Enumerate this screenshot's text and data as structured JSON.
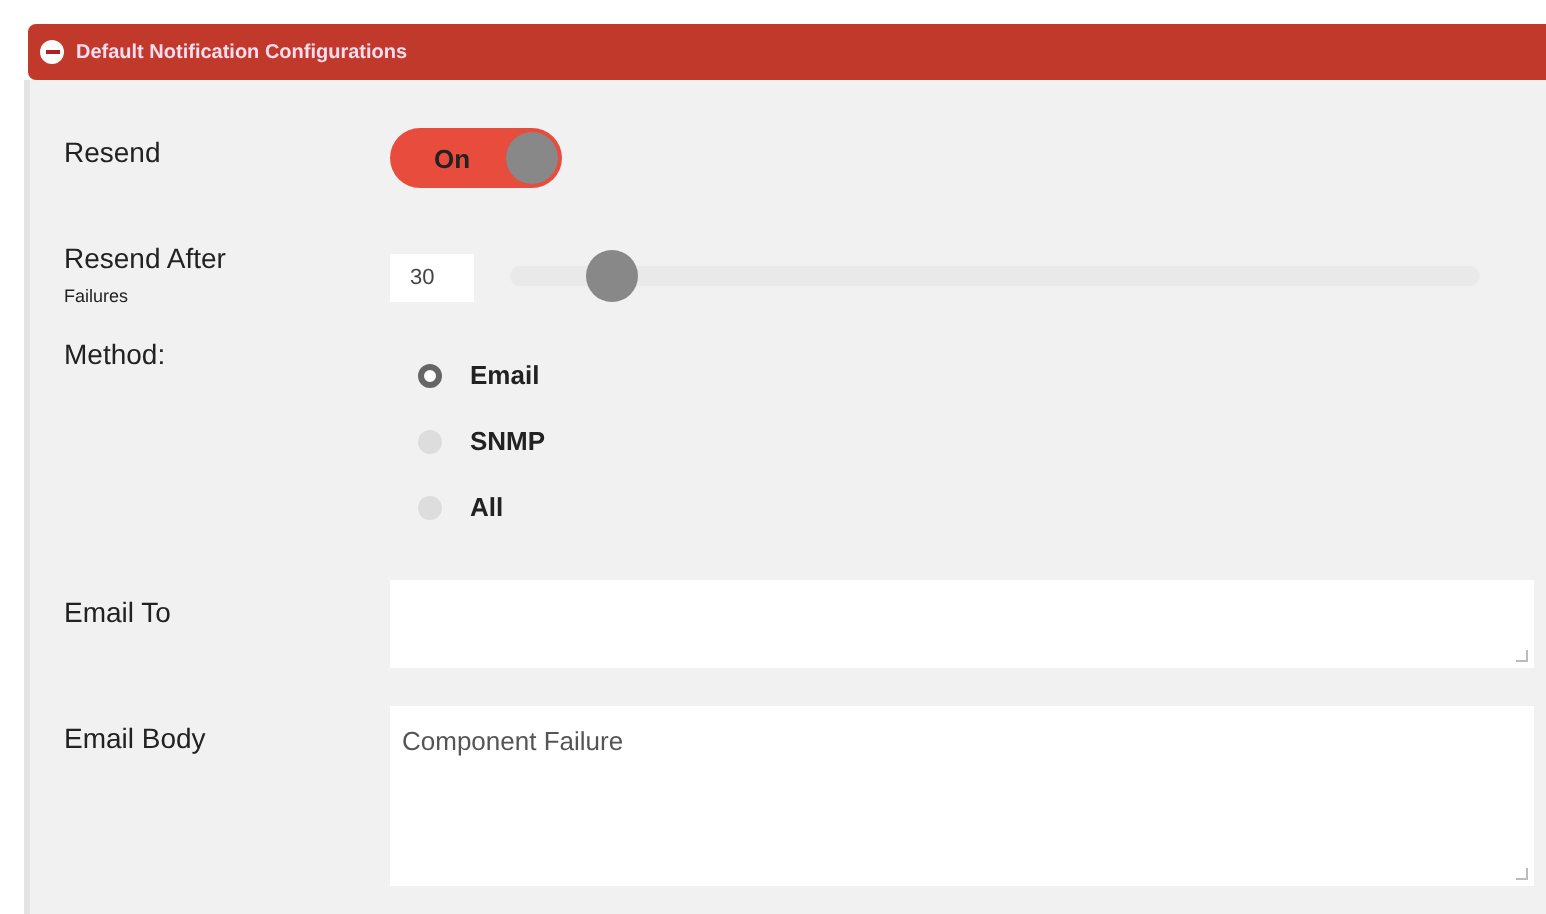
{
  "panel": {
    "title": "Default Notification Configurations",
    "expanded": true
  },
  "resend": {
    "label": "Resend",
    "toggle_text": "On",
    "on": true
  },
  "resend_after": {
    "label": "Resend After",
    "sublabel": "Failures",
    "value": "30",
    "level": 0.1
  },
  "method": {
    "label": "Method:",
    "options": [
      {
        "label": "Email",
        "selected": true
      },
      {
        "label": "SNMP",
        "selected": false
      },
      {
        "label": "All",
        "selected": false
      }
    ]
  },
  "email_to": {
    "label": "Email To"
  },
  "email_body": {
    "label": "Email Body",
    "value": "Component Failure"
  }
}
